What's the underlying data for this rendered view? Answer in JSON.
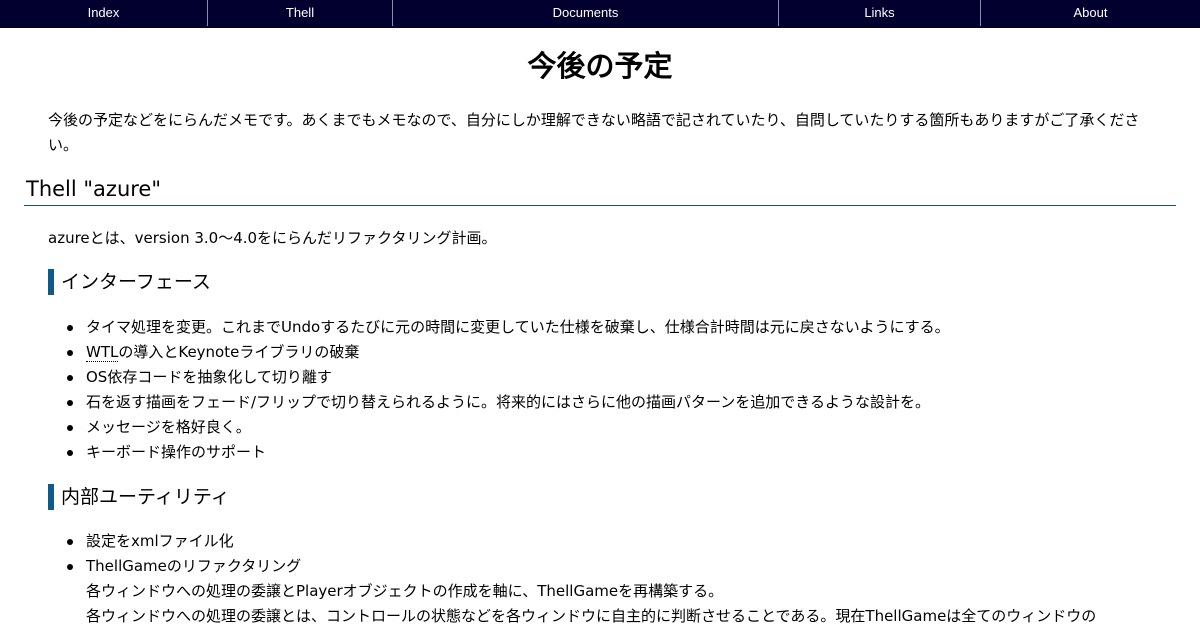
{
  "nav": {
    "items": [
      "Index",
      "Thell",
      "Documents",
      "Links",
      "About"
    ]
  },
  "page": {
    "title": "今後の予定",
    "intro": "今後の予定などをにらんだメモです。あくまでもメモなので、自分にしか理解できない略語で記されていたり、自問していたりする箇所もありますがご了承ください。"
  },
  "section": {
    "title": "Thell \"azure\"",
    "lead": "azureとは、version 3.0～4.0をにらんだリファクタリング計画。",
    "subsections": [
      {
        "title": "インターフェース",
        "items": [
          "タイマ処理を変更。これまでUndoするたびに元の時間に変更していた仕様を破棄し、仕様合計時間は元に戻さないようにする。",
          "の導入とKeynoteライブラリの破棄",
          "OS依存コードを抽象化して切り離す",
          "石を返す描画をフェード/フリップで切り替えられるように。将来的にはさらに他の描画パターンを追加できるような設計を。",
          "メッセージを格好良く。",
          "キーボード操作のサポート"
        ],
        "abbr": "WTL"
      },
      {
        "title": "内部ユーティリティ",
        "items": [
          "設定をxmlファイル化",
          "ThellGameのリファクタリング"
        ],
        "item2_lines": [
          "各ウィンドウへの処理の委譲とPlayerオブジェクトの作成を軸に、ThellGameを再構築する。",
          "各ウィンドウへの処理の委譲とは、コントロールの状態などを各ウィンドウに自主的に判断させることである。現在ThellGameは全てのウィンドウの"
        ]
      }
    ]
  }
}
